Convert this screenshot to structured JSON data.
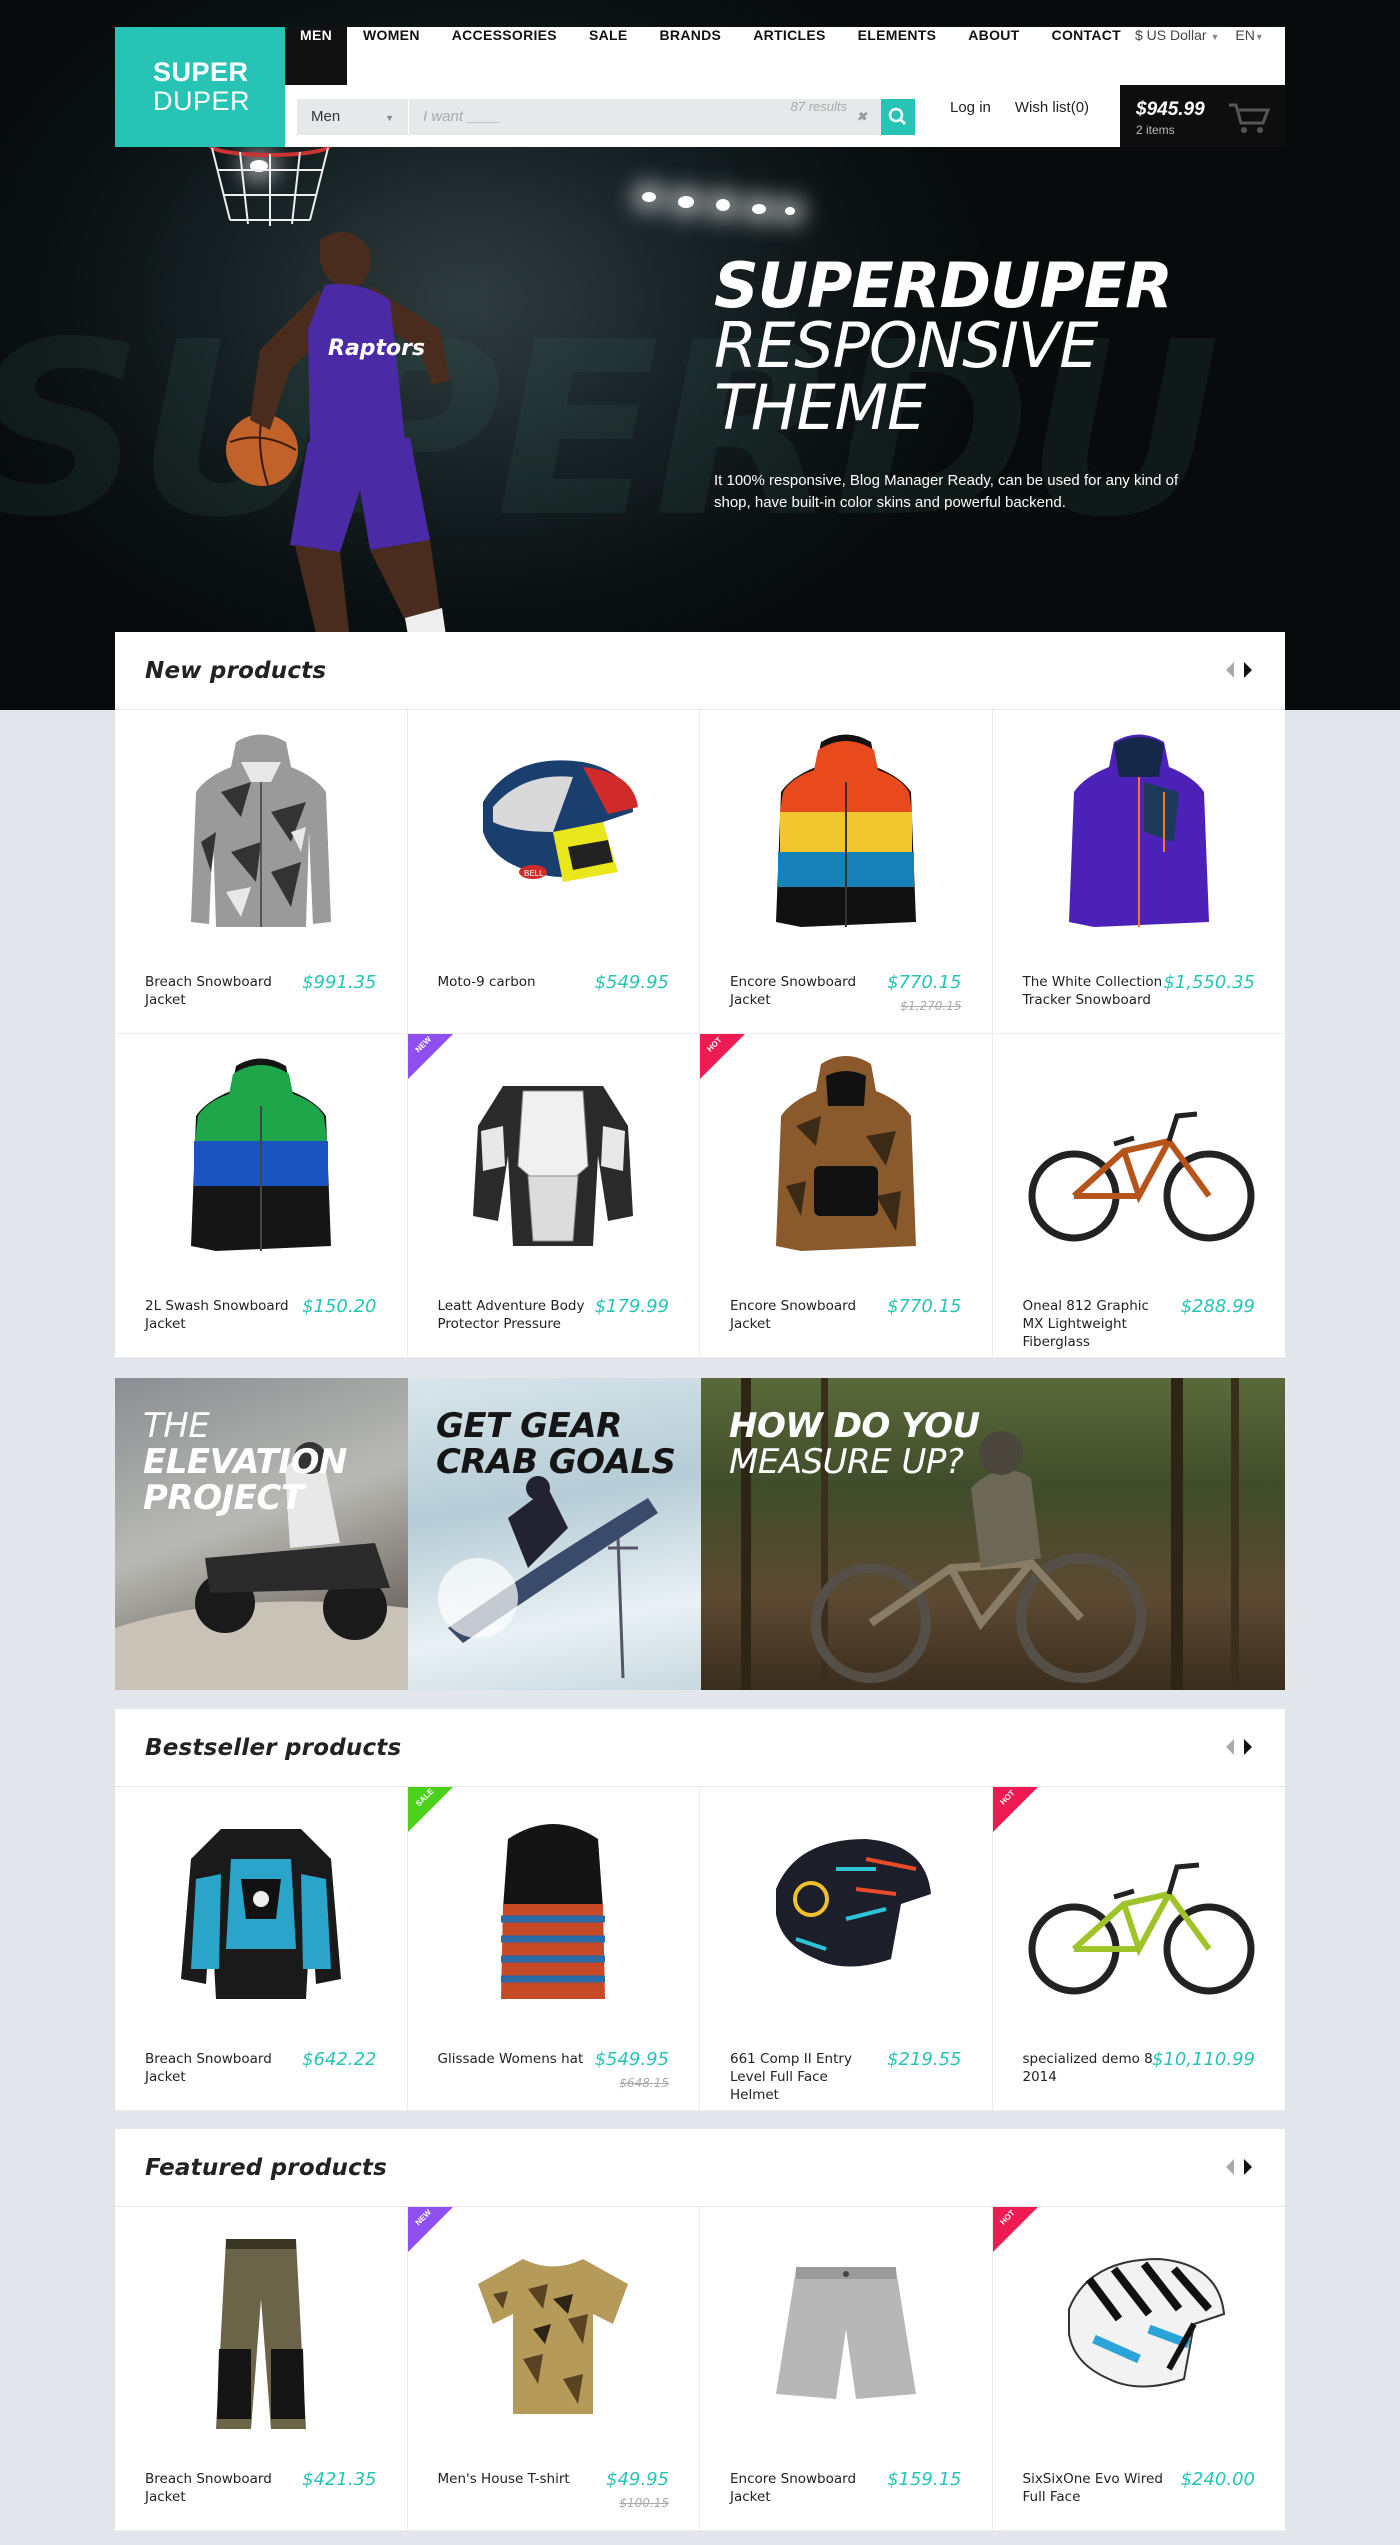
{
  "logo": {
    "line1": "SUPER",
    "line2": "DUPER"
  },
  "nav": {
    "items": [
      "MEN",
      "WOMEN",
      "ACCESSORIES",
      "SALE",
      "BRANDS",
      "ARTICLES",
      "ELEMENTS",
      "ABOUT",
      "CONTACT"
    ],
    "active": "MEN"
  },
  "header": {
    "currency": "$ US Dollar",
    "language": "EN",
    "login": "Log in",
    "wishlist": "Wish list(0)"
  },
  "search": {
    "category": "Men",
    "placeholder": "I want ____",
    "results": "87 results"
  },
  "cart": {
    "amount": "$945.99",
    "items": "2 items"
  },
  "hero": {
    "title": "SUPERDUPER",
    "subtitle_line1": "RESPONSIVE",
    "subtitle_line2": "THEME",
    "description": "It 100% responsive, Blog Manager Ready, can be used for any kind of shop, have built-in color skins and powerful backend."
  },
  "new_products": {
    "title": "New products",
    "items": [
      {
        "name": "Breach Snowboard Jacket",
        "price": "$991.35",
        "icon": "camo-jacket"
      },
      {
        "name": "Moto-9 carbon",
        "price": "$549.95",
        "icon": "moto-helmet"
      },
      {
        "name": "Encore Snowboard Jacket",
        "price": "$770.15",
        "old_price": "$1,270.15",
        "icon": "striped-jacket"
      },
      {
        "name": "The White Collection Tracker Snowboard",
        "price": "$1,550.35",
        "icon": "purple-jacket"
      },
      {
        "name": "2L Swash Snowboard Jacket",
        "price": "$150.20",
        "icon": "green-blue-jacket"
      },
      {
        "name": "Leatt Adventure Body Protector Pressure",
        "price": "$179.99",
        "badge": "NEW",
        "icon": "body-protector"
      },
      {
        "name": "Encore Snowboard Jacket",
        "price": "$770.15",
        "badge": "HOT",
        "icon": "camo-anorak"
      },
      {
        "name": "Oneal 812 Graphic MX Lightweight Fiberglass",
        "price": "$288.99",
        "icon": "mountain-bike"
      }
    ]
  },
  "banners": [
    {
      "line1": "THE",
      "line2": "ELEVATION",
      "line3": "PROJECT"
    },
    {
      "line1": "GET GEAR",
      "line2": "CRAB GOALS"
    },
    {
      "line1": "HOW DO YOU",
      "line2": "MEASURE UP?"
    }
  ],
  "bestseller_products": {
    "title": "Bestseller products",
    "items": [
      {
        "name": "Breach Snowboard Jacket",
        "price": "$642.22",
        "icon": "armor-jacket"
      },
      {
        "name": "Glissade Womens hat",
        "price": "$549.95",
        "old_price": "$648.15",
        "badge": "SALE",
        "icon": "beanie"
      },
      {
        "name": "661 Comp II Entry Level Full Face Helmet",
        "price": "$219.55",
        "icon": "black-helmet"
      },
      {
        "name": "specialized demo 8 2014",
        "price": "$10,110.99",
        "badge": "HOT",
        "icon": "downhill-bike"
      }
    ]
  },
  "featured_products": {
    "title": "Featured products",
    "items": [
      {
        "name": "Breach Snowboard Jacket",
        "price": "$421.35",
        "icon": "pants"
      },
      {
        "name": "Men's House T-shirt",
        "price": "$49.95",
        "old_price": "$100.15",
        "badge": "NEW",
        "icon": "camo-tshirt"
      },
      {
        "name": "Encore Snowboard Jacket",
        "price": "$159.15",
        "icon": "shorts"
      },
      {
        "name": "SixSixOne Evo Wired Full Face",
        "price": "$240.00",
        "badge": "HOT",
        "icon": "stripe-helmet"
      }
    ]
  },
  "colors": {
    "accent": "#27c4b6",
    "new_badge": "#8f4ef0",
    "hot_badge": "#ee1a52",
    "sale_badge": "#4cd11b"
  }
}
